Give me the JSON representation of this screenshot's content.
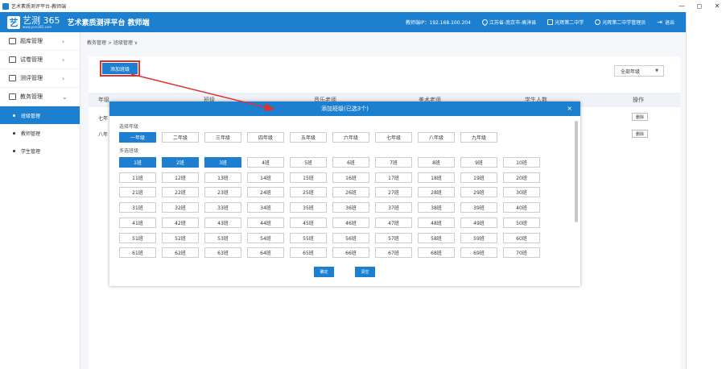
{
  "window": {
    "title": "艺术素质测评平台-教师端",
    "controls": [
      "—",
      "◻",
      "✕"
    ]
  },
  "topbar": {
    "brand": "艺测 365",
    "brand_url": "www.yice365.com",
    "logo_char": "艺",
    "platform_title": "艺术素质测评平台 教师端",
    "ip": "教师端IP：192.168.100.204",
    "location": "江苏省-南京市-高淳县",
    "school": "光辉第二中学",
    "admin": "光辉第二中学管理员",
    "logout": "退出"
  },
  "sidebar": {
    "items": [
      {
        "label": "题库管理",
        "icon": "question-bank-icon"
      },
      {
        "label": "试卷管理",
        "icon": "paper-icon"
      },
      {
        "label": "测评管理",
        "icon": "assessment-icon"
      },
      {
        "label": "教务管理",
        "icon": "academic-icon"
      }
    ],
    "subitems": [
      {
        "label": "班级管理",
        "active": true
      },
      {
        "label": "教师管理",
        "active": false
      },
      {
        "label": "学生管理",
        "active": false
      }
    ]
  },
  "breadcrumb": "教务管理 > 班级管理 ∨",
  "toolbar": {
    "add_class": "添加班级",
    "grade_filter": "全部年级"
  },
  "table": {
    "headers": [
      "年级",
      "班级",
      "音乐老师",
      "美术老师",
      "学生人数",
      "操作"
    ],
    "rows": [
      {
        "grade": "七年",
        "action": "删除"
      },
      {
        "grade": "八年",
        "action": "删除"
      }
    ]
  },
  "modal": {
    "title": "添加班级(已选3个)",
    "close": "×",
    "grade_label": "选择年级",
    "grades": [
      "一年级",
      "二年级",
      "三年级",
      "四年级",
      "五年级",
      "六年级",
      "七年级",
      "八年级",
      "九年级"
    ],
    "selected_grade": "一年级",
    "class_label": "多选班级",
    "classes": [
      [
        "1班",
        "2班",
        "3班",
        "4班",
        "5班",
        "6班",
        "7班",
        "8班",
        "9班",
        "10班"
      ],
      [
        "11班",
        "12班",
        "13班",
        "14班",
        "15班",
        "16班",
        "17班",
        "18班",
        "19班",
        "20班"
      ],
      [
        "21班",
        "22班",
        "23班",
        "24班",
        "25班",
        "26班",
        "27班",
        "28班",
        "29班",
        "30班"
      ],
      [
        "31班",
        "32班",
        "33班",
        "34班",
        "35班",
        "36班",
        "37班",
        "38班",
        "39班",
        "40班"
      ],
      [
        "41班",
        "42班",
        "43班",
        "44班",
        "45班",
        "46班",
        "47班",
        "48班",
        "49班",
        "50班"
      ],
      [
        "51班",
        "52班",
        "53班",
        "54班",
        "55班",
        "56班",
        "57班",
        "58班",
        "59班",
        "60班"
      ],
      [
        "61班",
        "62班",
        "63班",
        "64班",
        "65班",
        "66班",
        "67班",
        "68班",
        "69班",
        "70班"
      ]
    ],
    "selected_classes": [
      "1班",
      "2班",
      "3班"
    ],
    "confirm": "确定",
    "clear": "清空"
  },
  "colors": {
    "primary": "#1c7fd0",
    "highlight_box": "#e03030",
    "arrow": "#e03030"
  }
}
